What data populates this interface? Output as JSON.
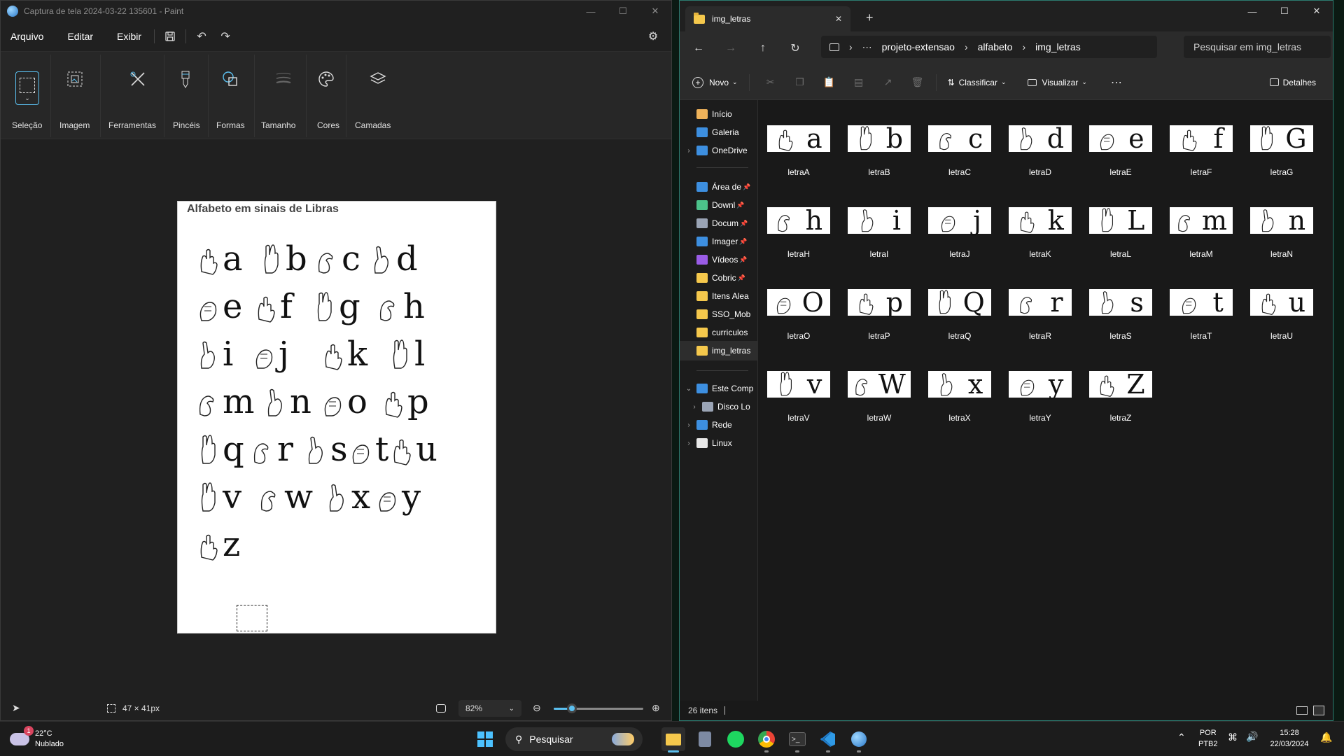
{
  "paint": {
    "title": "Captura de tela 2024-03-22 135601 - Paint",
    "menu": [
      "Arquivo",
      "Editar",
      "Exibir"
    ],
    "ribbon": [
      "Seleção",
      "Imagem",
      "Ferramentas",
      "Pincéis",
      "Formas",
      "Tamanho",
      "Cores",
      "Camadas"
    ],
    "document_title": "Alfabeto em sinais de Libras",
    "letters": [
      "a",
      "b",
      "c",
      "d",
      "e",
      "f",
      "g",
      "h",
      "i",
      "j",
      "k",
      "l",
      "m",
      "n",
      "o",
      "p",
      "q",
      "r",
      "s",
      "t",
      "u",
      "v",
      "w",
      "x",
      "y",
      "z"
    ],
    "status": {
      "selection": "47 × 41px",
      "zoom": "82%",
      "zoom_level_percent": 82
    }
  },
  "explorer": {
    "tab_title": "img_letras",
    "breadcrumb": [
      "projeto-extensao",
      "alfabeto",
      "img_letras"
    ],
    "search_placeholder": "Pesquisar em img_letras",
    "commands": {
      "new": "Novo",
      "sort": "Classificar",
      "view": "Visualizar",
      "details": "Detalhes"
    },
    "sidebar": [
      {
        "label": "Início",
        "icon": "home-icon"
      },
      {
        "label": "Galeria",
        "icon": "gallery-icon"
      },
      {
        "label": "OneDrive",
        "icon": "cloud-icon"
      },
      {
        "label": "Área de",
        "icon": "desktop-icon"
      },
      {
        "label": "Downl",
        "icon": "download-icon"
      },
      {
        "label": "Docum",
        "icon": "document-icon"
      },
      {
        "label": "Imager",
        "icon": "pictures-icon"
      },
      {
        "label": "Vídeos",
        "icon": "videos-icon"
      },
      {
        "label": "Cobric",
        "icon": "folder-icon"
      },
      {
        "label": "Itens Alea",
        "icon": "folder-icon"
      },
      {
        "label": "SSO_Mob",
        "icon": "folder-icon"
      },
      {
        "label": "curriculos",
        "icon": "folder-icon"
      },
      {
        "label": "img_letras",
        "icon": "folder-icon"
      },
      {
        "label": "Este Comp",
        "icon": "computer-icon"
      },
      {
        "label": "Disco Lo",
        "icon": "drive-icon"
      },
      {
        "label": "Rede",
        "icon": "network-icon"
      },
      {
        "label": "Linux",
        "icon": "linux-icon"
      }
    ],
    "files": [
      {
        "name": "letraA",
        "glyph": "a"
      },
      {
        "name": "letraB",
        "glyph": "b"
      },
      {
        "name": "letraC",
        "glyph": "c"
      },
      {
        "name": "letraD",
        "glyph": "d"
      },
      {
        "name": "letraE",
        "glyph": "e"
      },
      {
        "name": "letraF",
        "glyph": "f"
      },
      {
        "name": "letraG",
        "glyph": "G"
      },
      {
        "name": "letraH",
        "glyph": "h"
      },
      {
        "name": "letraI",
        "glyph": "i"
      },
      {
        "name": "letraJ",
        "glyph": "j"
      },
      {
        "name": "letraK",
        "glyph": "k"
      },
      {
        "name": "letraL",
        "glyph": "L"
      },
      {
        "name": "letraM",
        "glyph": "m"
      },
      {
        "name": "letraN",
        "glyph": "n"
      },
      {
        "name": "letraO",
        "glyph": "O"
      },
      {
        "name": "letraP",
        "glyph": "p"
      },
      {
        "name": "letraQ",
        "glyph": "Q"
      },
      {
        "name": "letraR",
        "glyph": "r"
      },
      {
        "name": "letraS",
        "glyph": "s"
      },
      {
        "name": "letraT",
        "glyph": "t"
      },
      {
        "name": "letraU",
        "glyph": "u"
      },
      {
        "name": "letraV",
        "glyph": "v"
      },
      {
        "name": "letraW",
        "glyph": "W"
      },
      {
        "name": "letraX",
        "glyph": "x"
      },
      {
        "name": "letraY",
        "glyph": "y"
      },
      {
        "name": "letraZ",
        "glyph": "Z"
      }
    ],
    "item_count": "26 itens"
  },
  "taskbar": {
    "weather": {
      "temp": "22°C",
      "condition": "Nublado",
      "badge": "1"
    },
    "search": "Pesquisar",
    "lang": [
      "POR",
      "PTB2"
    ],
    "time": "15:28",
    "date": "22/03/2024"
  },
  "colors": {
    "accent": "#5bc0f0",
    "explorer_border": "#2b7b6f",
    "folder": "#f5c84c"
  }
}
